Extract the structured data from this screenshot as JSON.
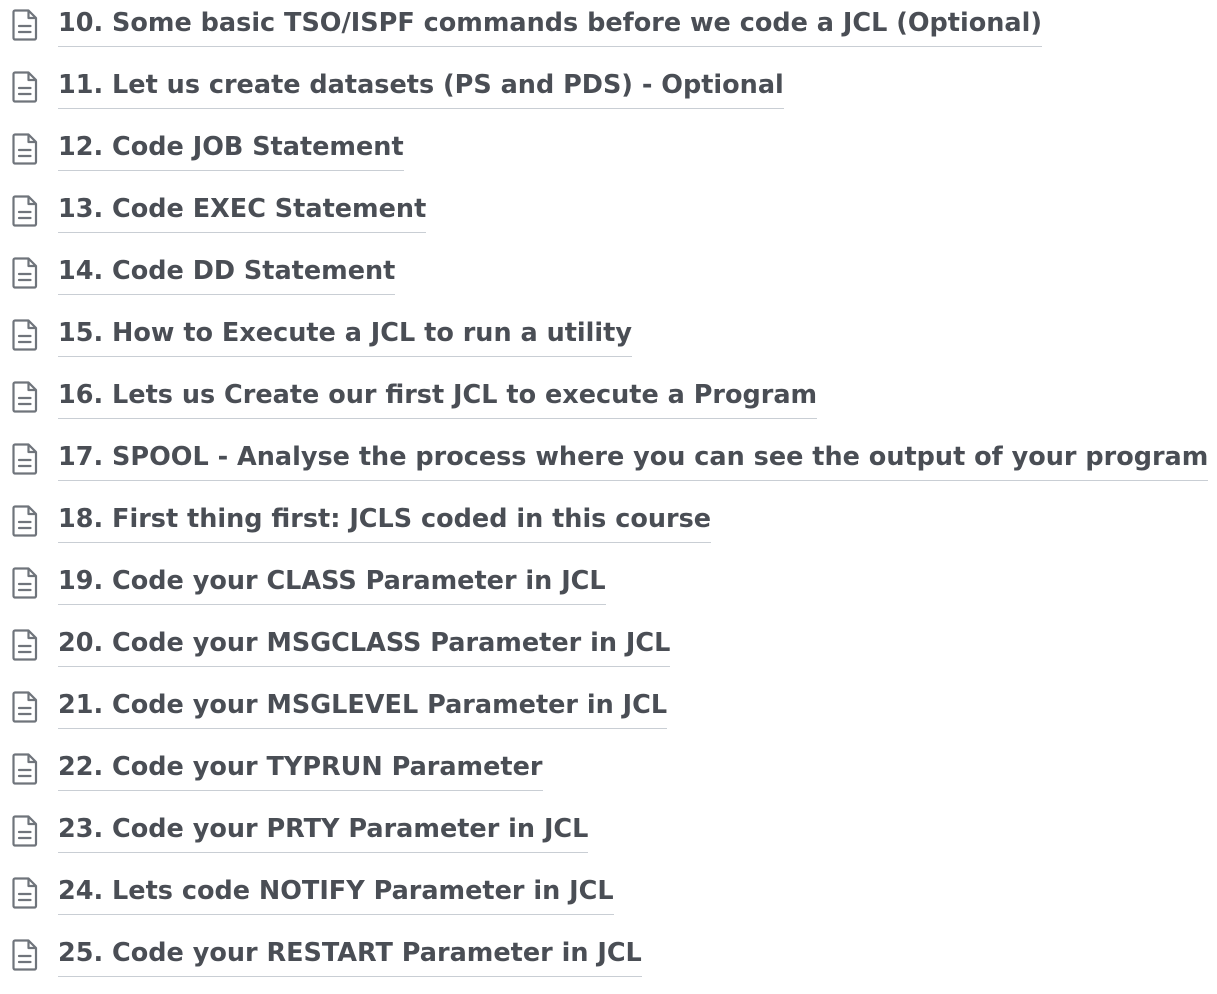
{
  "lessons": [
    {
      "label": "10. Some basic TSO/ISPF commands before we code a JCL (Optional)"
    },
    {
      "label": "11. Let us create datasets (PS and PDS) - Optional"
    },
    {
      "label": "12. Code JOB Statement"
    },
    {
      "label": "13. Code EXEC Statement"
    },
    {
      "label": "14. Code DD Statement"
    },
    {
      "label": "15. How to Execute a JCL to run a utility"
    },
    {
      "label": "16. Lets us Create our first JCL to execute a Program"
    },
    {
      "label": "17. SPOOL - Analyse the process where you can see the output of your program"
    },
    {
      "label": "18. First thing first: JCLS coded in this course"
    },
    {
      "label": "19. Code your CLASS Parameter in JCL"
    },
    {
      "label": "20. Code your MSGCLASS Parameter in JCL"
    },
    {
      "label": "21. Code your MSGLEVEL Parameter in JCL"
    },
    {
      "label": "22. Code your TYPRUN Parameter"
    },
    {
      "label": "23. Code your PRTY Parameter in JCL"
    },
    {
      "label": "24. Lets code NOTIFY Parameter in JCL"
    },
    {
      "label": "25. Code your RESTART Parameter in JCL"
    }
  ],
  "icon": "document-icon",
  "colors": {
    "text": "#4a4e55",
    "icon": "#6f747b",
    "underline": "#c9ced4"
  }
}
